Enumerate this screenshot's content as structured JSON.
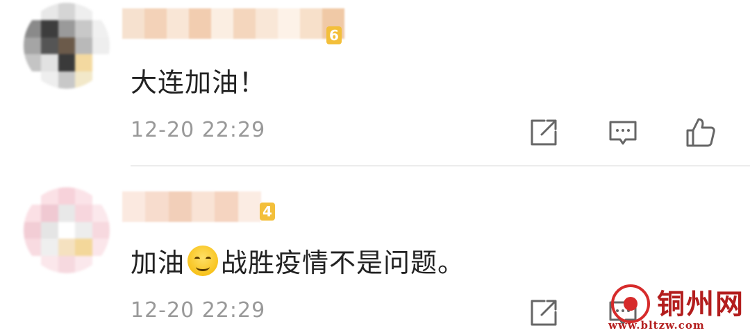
{
  "comments": [
    {
      "text": "大连加油！",
      "time": "12-20 22:29",
      "level": "6"
    },
    {
      "text_before": "加油",
      "text_after": "战胜疫情不是问题。",
      "emoji": "smiling-face-emoji",
      "time": "12-20 22:29",
      "level": "4"
    }
  ],
  "icons": {
    "share": "share-icon",
    "reply": "comment-icon",
    "like": "thumbs-up-icon"
  },
  "watermark": {
    "name": "铜州网",
    "url": "www.bltzw.com"
  },
  "colors": {
    "text": "#222222",
    "meta": "#999999",
    "icon": "#666666",
    "divider": "#ececec",
    "level_badge": "#f3bf3a",
    "watermark": "#b31d1d"
  }
}
